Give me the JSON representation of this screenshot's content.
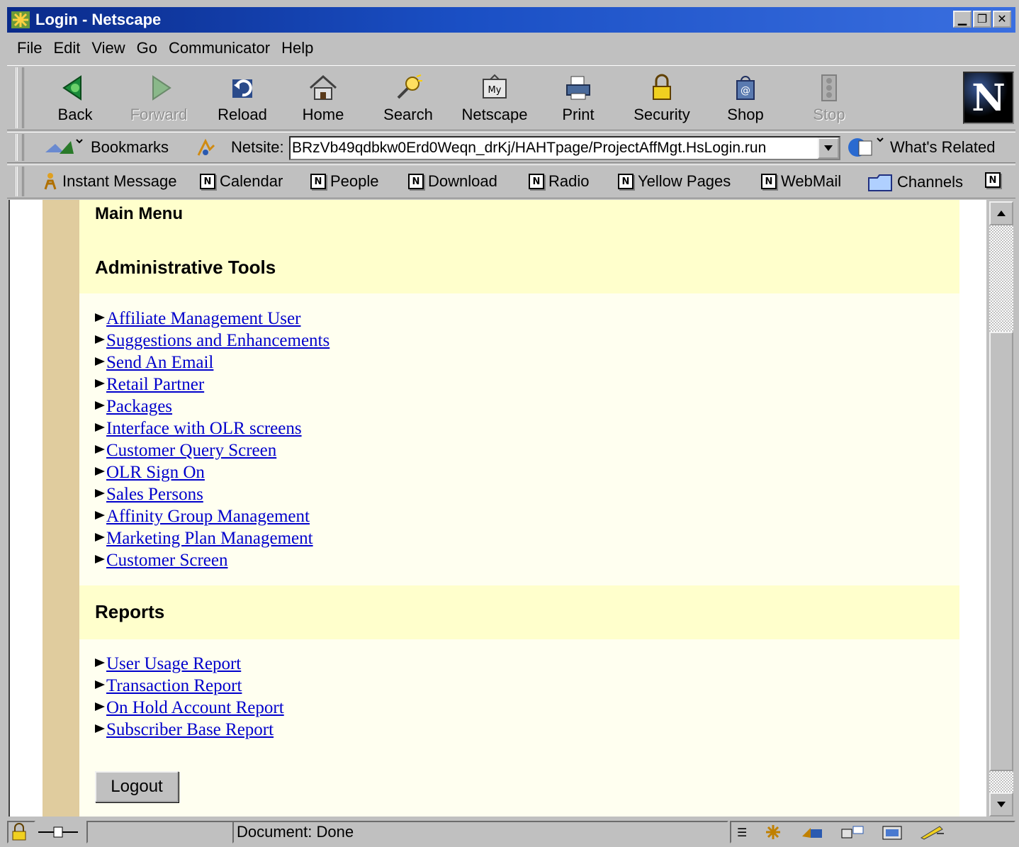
{
  "window": {
    "title": "Login - Netscape",
    "buttons": [
      "minimize",
      "restore",
      "close"
    ]
  },
  "menu": {
    "items": [
      {
        "label": "File",
        "accel": "F"
      },
      {
        "label": "Edit",
        "accel": "E"
      },
      {
        "label": "View",
        "accel": "V"
      },
      {
        "label": "Go",
        "accel": "G"
      },
      {
        "label": "Communicator",
        "accel": "C"
      },
      {
        "label": "Help",
        "accel": "H"
      }
    ]
  },
  "toolbar": {
    "back": "Back",
    "forward": "Forward",
    "reload": "Reload",
    "home": "Home",
    "search": "Search",
    "netscape": "Netscape",
    "print": "Print",
    "security": "Security",
    "shop": "Shop",
    "stop": "Stop",
    "logo": "N"
  },
  "location": {
    "bookmarks_label": "Bookmarks",
    "netsite_label": "Netsite:",
    "url": "BRzVb49qdbkw0Erd0Weqn_drKj/HAHTpage/ProjectAffMgt.HsLogin.run",
    "whats_related": "What's Related"
  },
  "personal_toolbar": {
    "instant_message": "Instant Message",
    "calendar": "Calendar",
    "people": "People",
    "download": "Download",
    "radio": "Radio",
    "yellow_pages": "Yellow Pages",
    "webmail": "WebMail",
    "channels": "Channels",
    "n_glyph": "N"
  },
  "page": {
    "main_menu": "Main Menu",
    "admin_heading": "Administrative Tools",
    "admin_links": [
      "Affiliate Management User",
      "Suggestions and Enhancements",
      "Send An Email",
      "Retail Partner",
      "Packages",
      "Interface with OLR screens",
      "Customer Query Screen",
      "OLR Sign On",
      "Sales Persons",
      "Affinity Group Management",
      "Marketing Plan Management",
      "Customer Screen"
    ],
    "reports_heading": "Reports",
    "report_links": [
      "User Usage Report",
      "Transaction Report",
      "On Hold Account Report",
      "Subscriber Base Report"
    ],
    "logout": "Logout"
  },
  "status": {
    "text": "Document: Done"
  },
  "colors": {
    "title_gradient_start": "#0a2a8a",
    "title_gradient_end": "#3a6fe0",
    "chrome": "#c0c0c0",
    "stripe": "#e0cc9e",
    "panel": "#fffff0",
    "band": "#ffffcc",
    "link": "#0000cc"
  }
}
